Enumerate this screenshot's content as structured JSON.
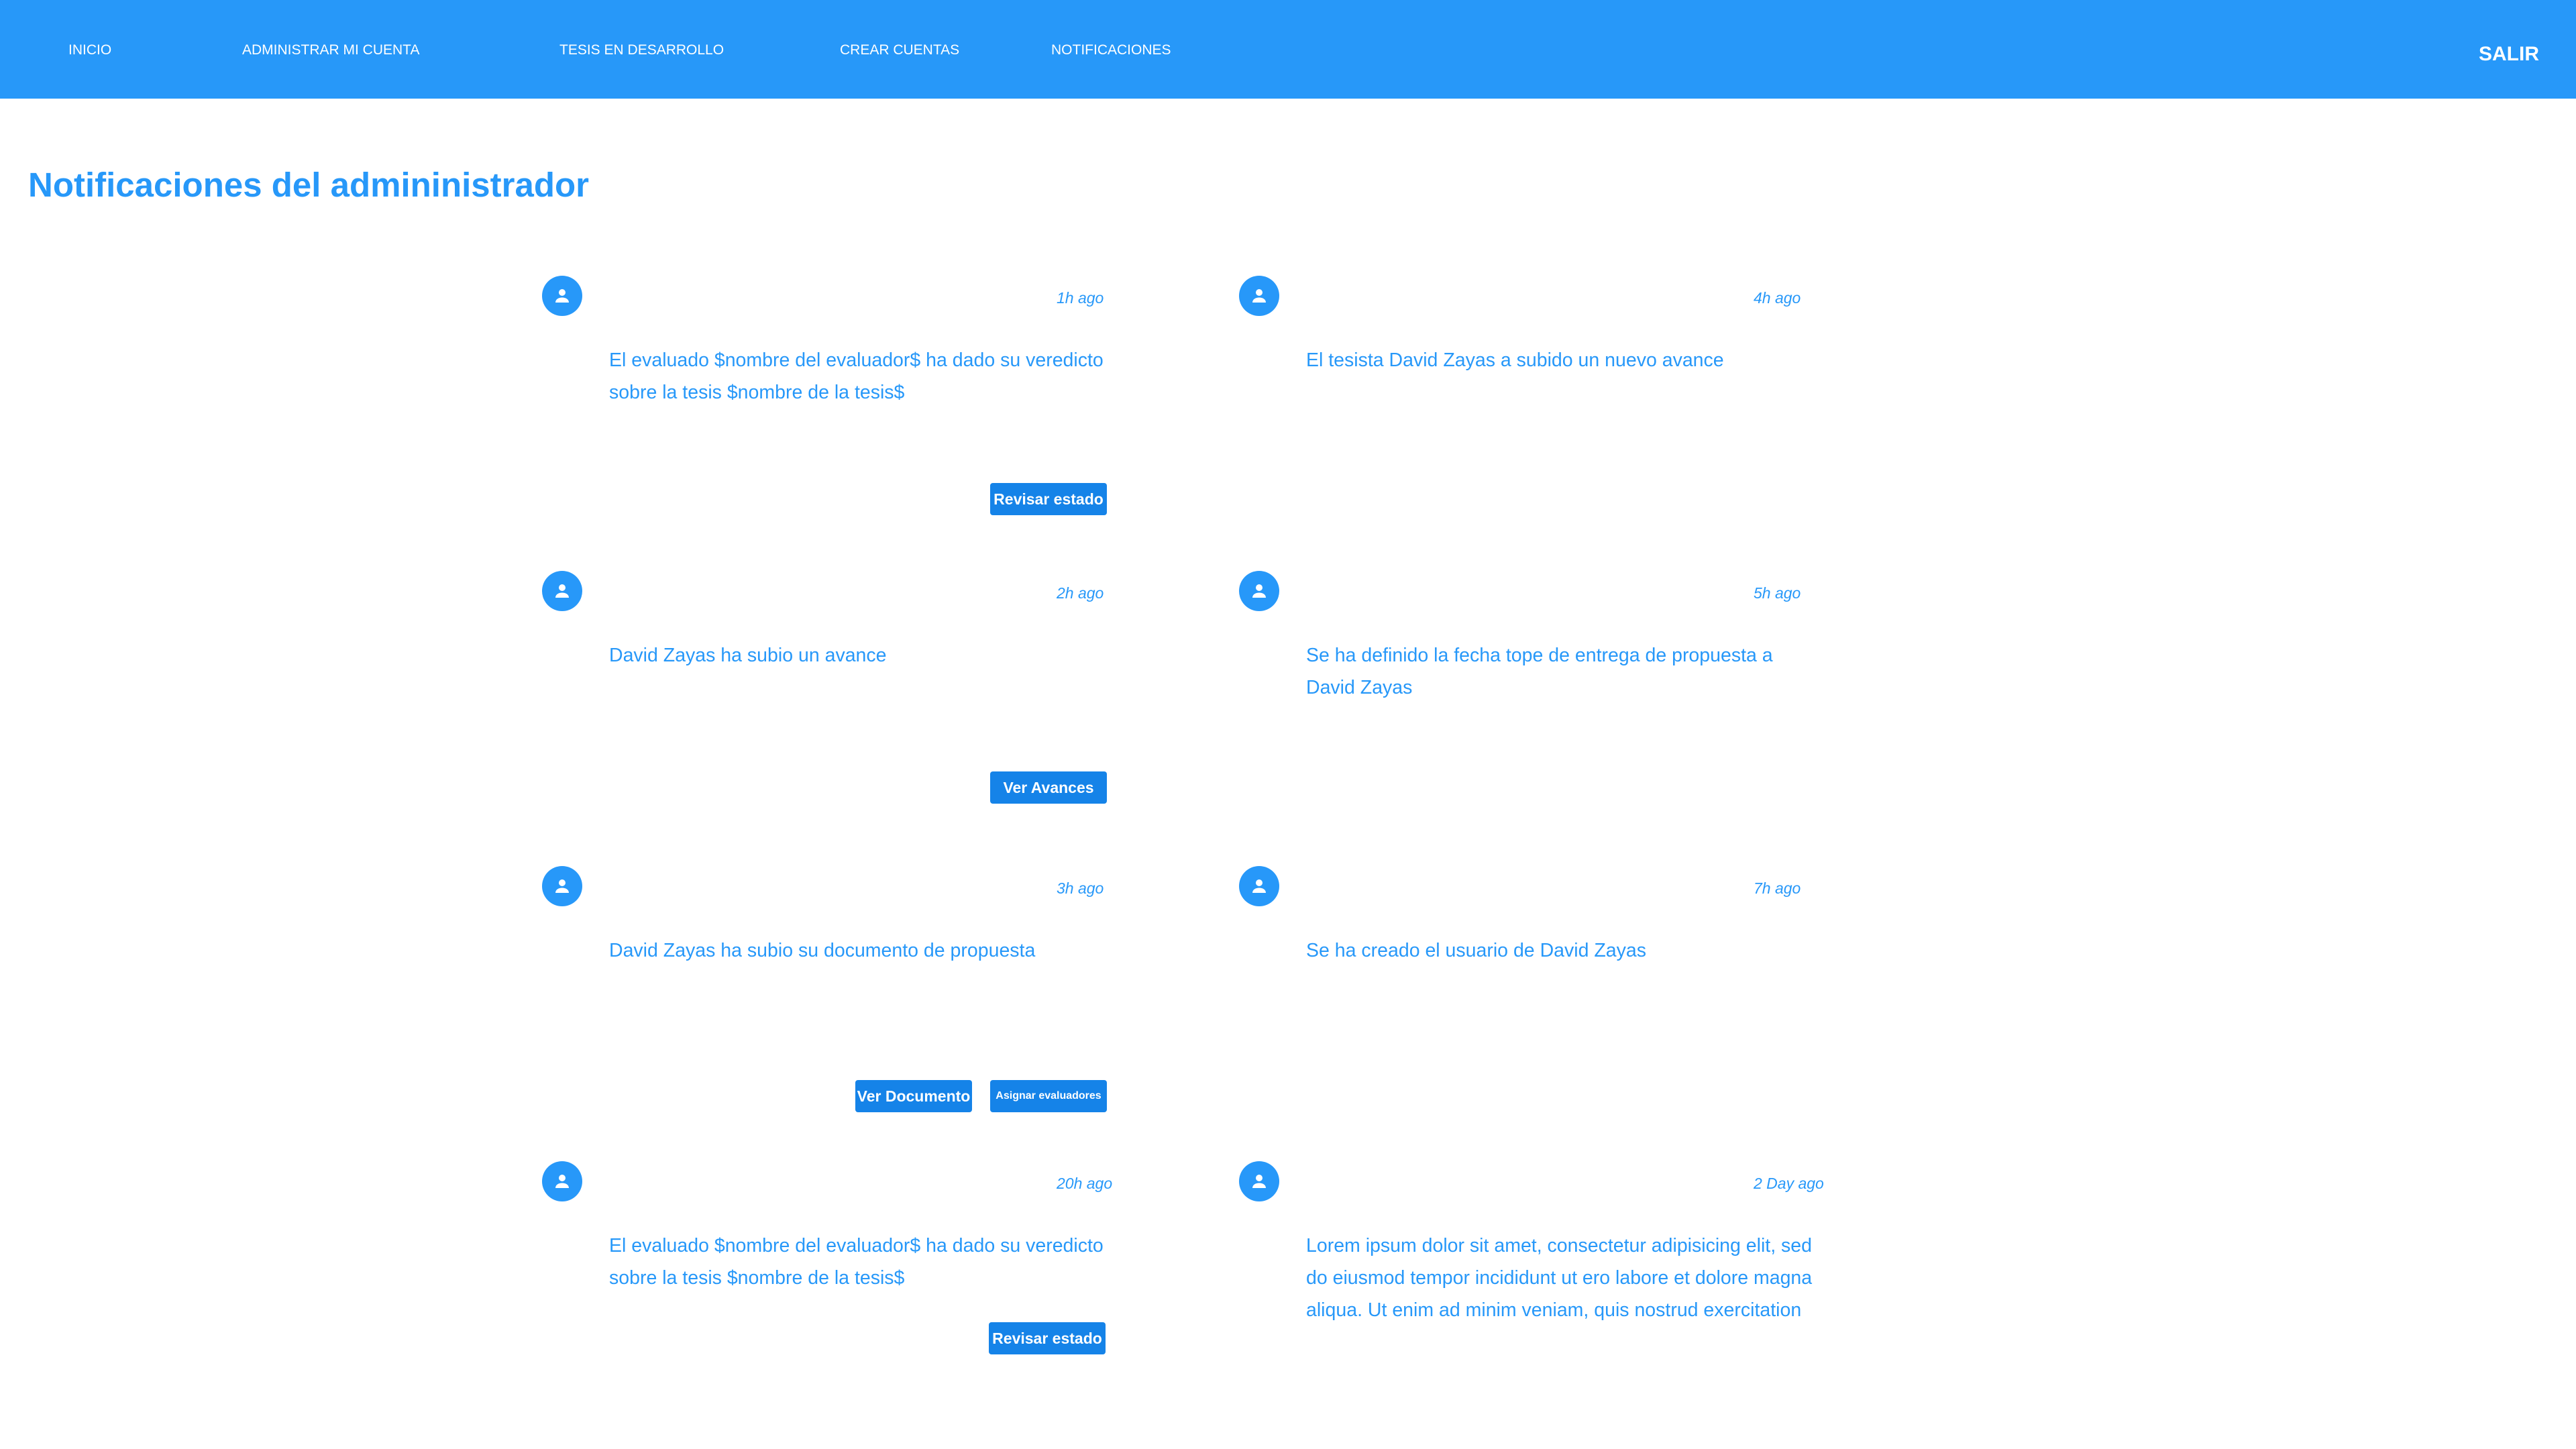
{
  "nav": {
    "items": [
      {
        "label": "INICIO"
      },
      {
        "label": "ADMINISTRAR MI CUENTA"
      },
      {
        "label": "TESIS EN DESARROLLO"
      },
      {
        "label": "CREAR CUENTAS"
      },
      {
        "label": "NOTIFICACIONES"
      }
    ],
    "logout": "SALIR"
  },
  "page": {
    "title": "Notificaciones del admininistrador"
  },
  "notifications": [
    {
      "time": "1h ago",
      "message": "El evaluado $nombre del evaluador$  ha dado su veredicto sobre la tesis $nombre de la tesis$",
      "buttons": [
        "Revisar estado"
      ]
    },
    {
      "time": "4h ago",
      "message": "El tesista David Zayas a subido un nuevo avance",
      "buttons": []
    },
    {
      "time": "2h ago",
      "message": "David Zayas ha subio un avance",
      "buttons": [
        "Ver Avances"
      ]
    },
    {
      "time": "5h ago",
      "message": "Se ha definido la fecha tope de entrega de propuesta a David Zayas",
      "buttons": []
    },
    {
      "time": "3h ago",
      "message": "David Zayas ha subio su documento de propuesta",
      "buttons": [
        "Ver Documento",
        "Asignar evaluadores"
      ]
    },
    {
      "time": "7h ago",
      "message": "Se ha creado el usuario de David Zayas",
      "buttons": []
    },
    {
      "time": "20h ago",
      "message": "El evaluado $nombre del evaluador$  ha dado su veredicto sobre la tesis $nombre de la tesis$",
      "buttons": [
        "Revisar estado"
      ]
    },
    {
      "time": "2 Day ago",
      "message": "Lorem ipsum dolor sit amet, consectetur adipisicing elit, sed do eiusmod tempor incididunt ut ero labore et dolore magna aliqua. Ut enim ad minim veniam, quis nostrud exercitation",
      "buttons": []
    }
  ],
  "colors": {
    "primary": "#2798f9",
    "button": "#1583e8",
    "background": "#ffffff"
  },
  "icons": {
    "avatar": "user-icon"
  }
}
